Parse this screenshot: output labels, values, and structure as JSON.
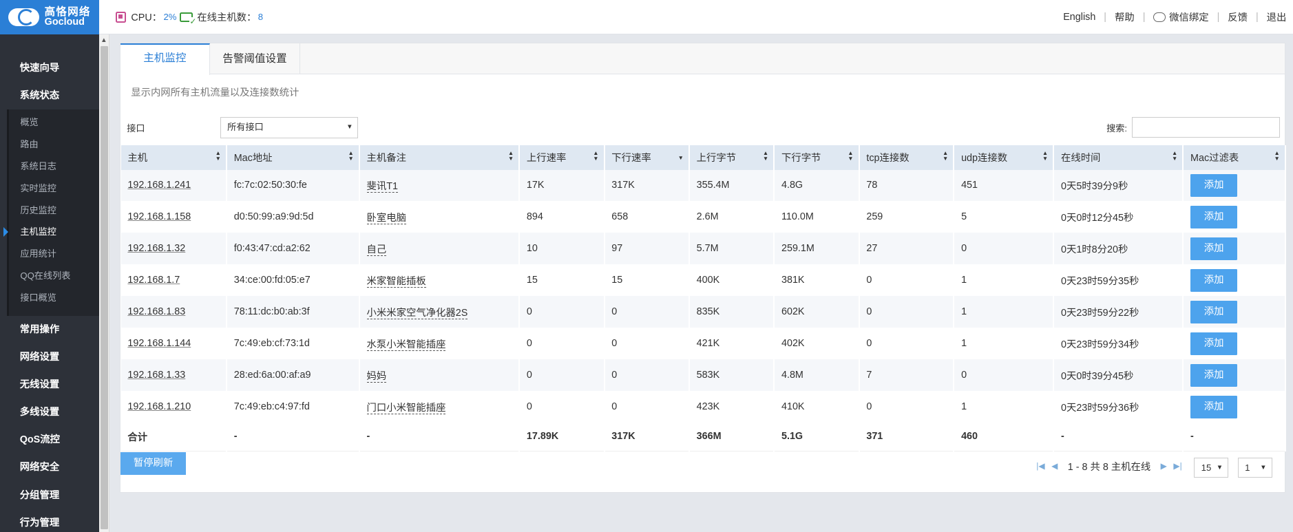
{
  "brand": {
    "name_cn": "高恪网络",
    "name_en": "Gocloud"
  },
  "topbar": {
    "cpu_label": "CPU：",
    "cpu_value": "2%",
    "online_label": "在线主机数：",
    "online_value": "8",
    "links": [
      "English",
      "帮助",
      "微信绑定",
      "反馈",
      "退出"
    ]
  },
  "sidebar": {
    "items": [
      "快速向导",
      "系统状态"
    ],
    "sub_items": [
      "概览",
      "路由",
      "系统日志",
      "实时监控",
      "历史监控",
      "主机监控",
      "应用统计",
      "QQ在线列表",
      "接口概览"
    ],
    "active_sub": "主机监控",
    "items_after": [
      "常用操作",
      "网络设置",
      "无线设置",
      "多线设置",
      "QoS流控",
      "网络安全",
      "分组管理",
      "行为管理"
    ]
  },
  "tabs": [
    "主机监控",
    "告警阈值设置"
  ],
  "description": "显示内网所有主机流量以及连接数统计",
  "filters": {
    "interface_label": "接口",
    "interface_value": "所有接口",
    "search_label": "搜索:"
  },
  "table": {
    "headers": [
      "主机",
      "Mac地址",
      "主机备注",
      "上行速率",
      "下行速率",
      "上行字节",
      "下行字节",
      "tcp连接数",
      "udp连接数",
      "在线时间",
      "Mac过滤表"
    ],
    "rows": [
      [
        "192.168.1.241",
        "fc:7c:02:50:30:fe",
        "斐讯T1",
        "17K",
        "317K",
        "355.4M",
        "4.8G",
        "78",
        "451",
        "0天5时39分9秒",
        "添加"
      ],
      [
        "192.168.1.158",
        "d0:50:99:a9:9d:5d",
        "卧室电脑",
        "894",
        "658",
        "2.6M",
        "110.0M",
        "259",
        "5",
        "0天0时12分45秒",
        "添加"
      ],
      [
        "192.168.1.32",
        "f0:43:47:cd:a2:62",
        "自己",
        "10",
        "97",
        "5.7M",
        "259.1M",
        "27",
        "0",
        "0天1时8分20秒",
        "添加"
      ],
      [
        "192.168.1.7",
        "34:ce:00:fd:05:e7",
        "米家智能插板",
        "15",
        "15",
        "400K",
        "381K",
        "0",
        "1",
        "0天23时59分35秒",
        "添加"
      ],
      [
        "192.168.1.83",
        "78:11:dc:b0:ab:3f",
        "小米米家空气净化器2S",
        "0",
        "0",
        "835K",
        "602K",
        "0",
        "1",
        "0天23时59分22秒",
        "添加"
      ],
      [
        "192.168.1.144",
        "7c:49:eb:cf:73:1d",
        "水泵小米智能插座",
        "0",
        "0",
        "421K",
        "402K",
        "0",
        "1",
        "0天23时59分34秒",
        "添加"
      ],
      [
        "192.168.1.33",
        "28:ed:6a:00:af:a9",
        "妈妈",
        "0",
        "0",
        "583K",
        "4.8M",
        "7",
        "0",
        "0天0时39分45秒",
        "添加"
      ],
      [
        "192.168.1.210",
        "7c:49:eb:c4:97:fd",
        "门口小米智能插座",
        "0",
        "0",
        "423K",
        "410K",
        "0",
        "1",
        "0天23时59分36秒",
        "添加"
      ]
    ],
    "total": [
      "合计",
      "-",
      "-",
      "17.89K",
      "317K",
      "366M",
      "5.1G",
      "371",
      "460",
      "-",
      "-"
    ]
  },
  "footer": {
    "pause_button": "暂停刷新",
    "pager_text": "1 - 8 共 8 主机在线",
    "page_size": "15",
    "page": "1"
  }
}
